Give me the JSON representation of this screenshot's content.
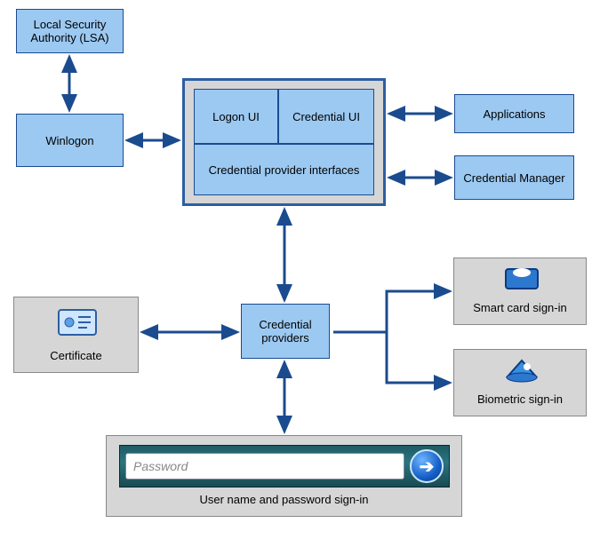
{
  "boxes": {
    "lsa": "Local Security Authority (LSA)",
    "winlogon": "Winlogon",
    "logon_ui": "Logon UI",
    "credential_ui": "Credential UI",
    "cp_interfaces": "Credential provider interfaces",
    "applications": "Applications",
    "credential_manager": "Credential Manager",
    "credential_providers": "Credential providers",
    "certificate": "Certificate",
    "smart_card": "Smart card sign-in",
    "biometric": "Biometric sign-in",
    "pw_label": "User name and password sign-in"
  },
  "password_placeholder": "Password",
  "colors": {
    "box_fill": "#9cc9f2",
    "box_border": "#1b4b8f",
    "arrow": "#1b4b8f",
    "panel_gray": "#d6d6d6"
  }
}
